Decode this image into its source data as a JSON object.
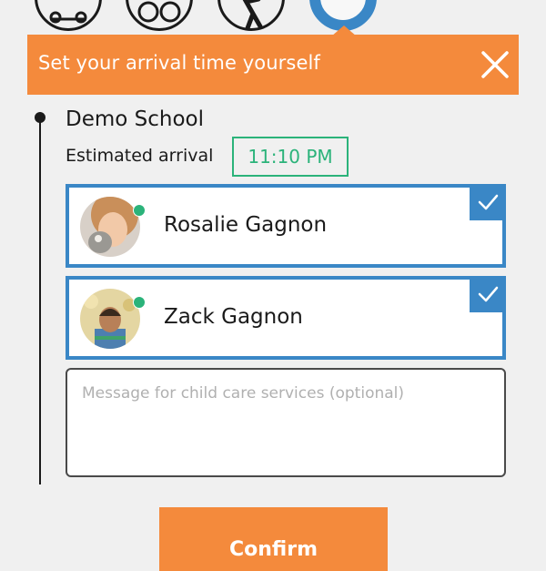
{
  "transport_modes": [
    {
      "icon": "car-icon",
      "selected": false
    },
    {
      "icon": "bicycle-icon",
      "selected": false
    },
    {
      "icon": "walking-icon",
      "selected": false
    },
    {
      "icon": "other-mode-icon",
      "selected": true
    }
  ],
  "banner": {
    "text": "Set your arrival time yourself",
    "close_icon": "close-icon",
    "color": "#f48a3c"
  },
  "destination": {
    "name": "Demo School",
    "arrival_label": "Estimated arrival",
    "arrival_time": "11:10 PM"
  },
  "children": [
    {
      "name": "Rosalie Gagnon",
      "checked": true,
      "online": true
    },
    {
      "name": "Zack Gagnon",
      "checked": true,
      "online": true
    }
  ],
  "message": {
    "placeholder": "Message for child care services (optional)",
    "value": ""
  },
  "confirm_label": "Confirm",
  "colors": {
    "accent_orange": "#f48a3c",
    "accent_blue": "#3a87c6",
    "time_green": "#2bb37a"
  }
}
